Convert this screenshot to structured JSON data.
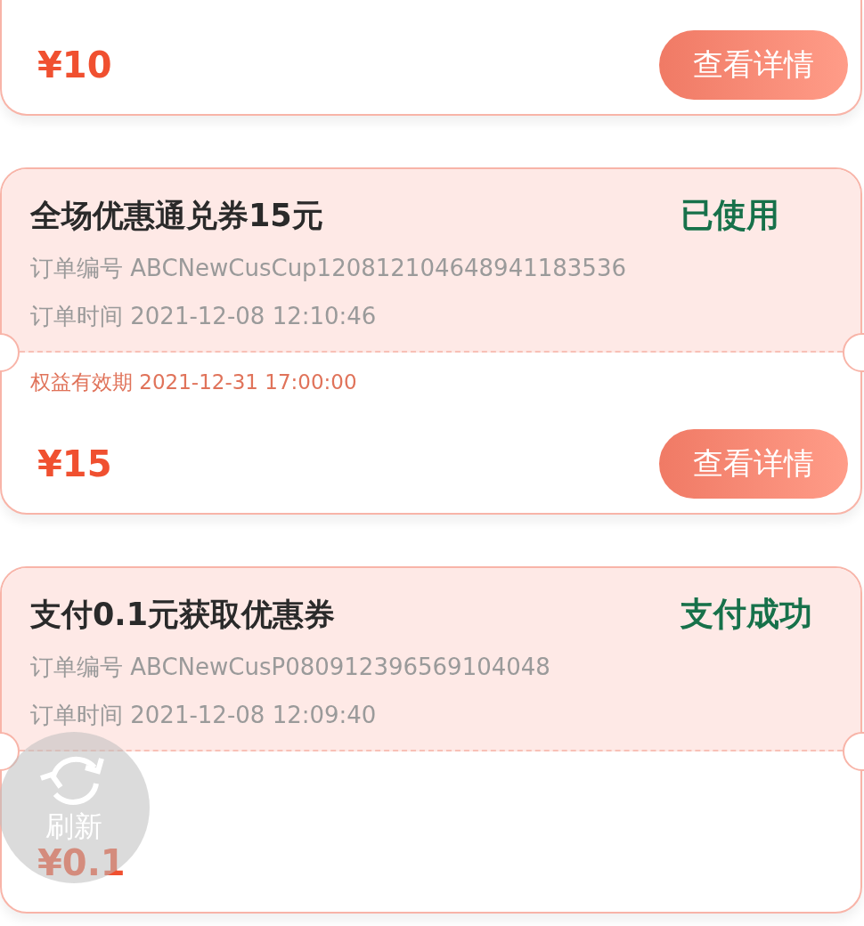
{
  "orders": [
    {
      "price": "¥10",
      "button": "查看详情"
    },
    {
      "title": "全场优惠通兑券15元",
      "status": "已使用",
      "order_no_label": "订单编号",
      "order_no": "ABCNewCusCup120812104648941183536",
      "time_label": "订单时间",
      "time": "2021-12-08 12:10:46",
      "validity_label": "权益有效期",
      "validity": "2021-12-31 17:00:00",
      "price": "¥15",
      "button": "查看详情"
    },
    {
      "title": "支付0.1元获取优惠券",
      "status": "支付成功",
      "order_no_label": "订单编号",
      "order_no": "ABCNewCusP080912396569104048",
      "time_label": "订单时间",
      "time": "2021-12-08 12:09:40",
      "price": "¥0.1"
    }
  ],
  "refresh_button": {
    "label": "刷新"
  }
}
